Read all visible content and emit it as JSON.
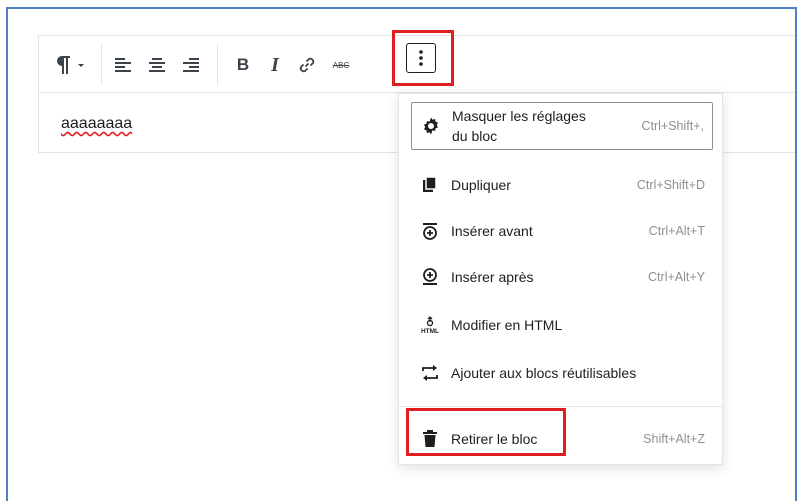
{
  "toolbar": {
    "paragraph_icon": "paragraph-icon",
    "bold_label": "B",
    "italic_label": "I",
    "strike_label": "ABC"
  },
  "block": {
    "text": "aaaaaaaa"
  },
  "menu": {
    "items": [
      {
        "label": "Masquer les réglages du bloc",
        "shortcut": "Ctrl+Shift+,",
        "icon": "gear-icon"
      },
      {
        "label": "Dupliquer",
        "shortcut": "Ctrl+Shift+D",
        "icon": "duplicate-icon"
      },
      {
        "label": "Insérer avant",
        "shortcut": "Ctrl+Alt+T",
        "icon": "insert-before-icon"
      },
      {
        "label": "Insérer après",
        "shortcut": "Ctrl+Alt+Y",
        "icon": "insert-after-icon"
      },
      {
        "label": "Modifier en HTML",
        "shortcut": "",
        "icon": "html-icon"
      },
      {
        "label": "Ajouter aux blocs réutilisables",
        "shortcut": "",
        "icon": "reusable-icon"
      },
      {
        "label": "Retirer le bloc",
        "shortcut": "Shift+Alt+Z",
        "icon": "trash-icon"
      }
    ]
  },
  "colors": {
    "highlight": "#e02020",
    "frame": "#4f80c6"
  }
}
